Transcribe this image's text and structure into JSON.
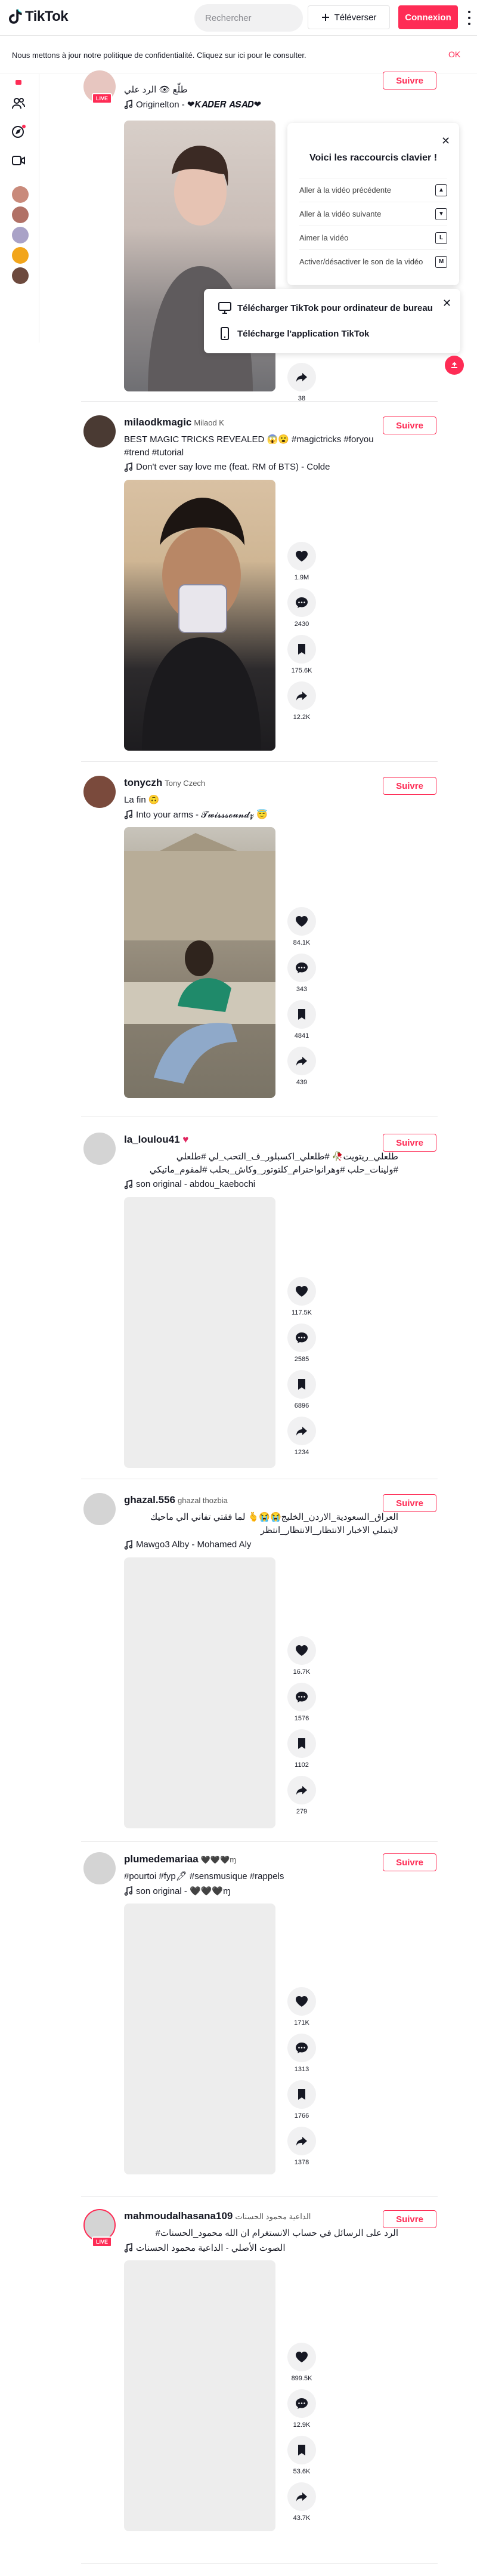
{
  "header": {
    "logo_text": "TikTok",
    "search_placeholder": "Rechercher",
    "upload_label": "Téléverser",
    "login_label": "Connexion"
  },
  "banner": {
    "text": "Nous mettons à jour notre politique de confidentialité. Cliquez sur ici pour le consulter.",
    "ok_label": "OK"
  },
  "keyboard_panel": {
    "title": "Voici les raccourcis clavier !",
    "shortcuts": [
      {
        "label": "Aller à la vidéo précédente",
        "key": "▲"
      },
      {
        "label": "Aller à la vidéo suivante",
        "key": "▼"
      },
      {
        "label": "Aimer la vidéo",
        "key": "L"
      },
      {
        "label": "Activer/désactiver le son de la vidéo",
        "key": "M"
      }
    ]
  },
  "download_panel": {
    "desktop_label": "Télécharger TikTok pour ordinateur de bureau",
    "mobile_label": "Télécharge l'application TikTok"
  },
  "posts": [
    {
      "username": "",
      "nickname": "",
      "caption": "طلّع 👁 الرد علي",
      "music": "Originelton - ❤𝑲𝑨𝑫𝑬𝑹 𝑨𝑺𝑨𝑫❤",
      "follow": "Suivre",
      "live": "LIVE",
      "actions": [
        {
          "count": "38"
        }
      ]
    },
    {
      "username": "milaodkmagic",
      "nickname": "Milaod K",
      "caption": "BEST MAGIC TRICKS REVEALED 😱😮 #magictricks #foryou #trend #tutorial",
      "music": "Don't ever say love me (feat. RM of BTS) - Colde",
      "follow": "Suivre",
      "actions": [
        {
          "count": "1.9M"
        },
        {
          "count": "2430"
        },
        {
          "count": "175.6K"
        },
        {
          "count": "12.2K"
        }
      ]
    },
    {
      "username": "tonyczh",
      "nickname": "Tony Czech",
      "caption": "La fin 🙃",
      "music": "Into your arms - 𝓣𝔀𝓲𝓼𝓼𝓼𝓸𝓾𝓷𝓭𝔃 😇",
      "follow": "Suivre",
      "actions": [
        {
          "count": "84.1K"
        },
        {
          "count": "343"
        },
        {
          "count": "4841"
        },
        {
          "count": "439"
        }
      ]
    },
    {
      "username": "la_loulou41",
      "nickname": "",
      "caption": "طلعلي_ريتويت🥀 #طلعلي_اكسبلور_ف_التحب_لي #طلعلي #ولينات_حلب #وهرانواحترام_كلتوتور_وكاش_بحلب #لمفوم_ماتيكي",
      "music": "son original - abdou_kaebochi",
      "follow": "Suivre",
      "actions": [
        {
          "count": "117.5K"
        },
        {
          "count": "2585"
        },
        {
          "count": "6896"
        },
        {
          "count": "1234"
        }
      ]
    },
    {
      "username": "ghazal.556",
      "nickname": "ghazal thozbia",
      "caption": "العراق_السعودية_الاردن_الخليج😭😭🫰 لما فقتي تفاني الي ماحيك لايتملي الاخبار الانتظار_الانتظار_انتظر",
      "music": "Mawgo3 Alby - Mohamed Aly",
      "follow": "Suivre",
      "actions": [
        {
          "count": "16.7K"
        },
        {
          "count": "1576"
        },
        {
          "count": "1102"
        },
        {
          "count": "279"
        }
      ]
    },
    {
      "username": "plumedemariaa",
      "nickname": "🖤🖤🖤ɱ",
      "caption": "#pourtoi #fyp🖊 #sensmusique #rappels",
      "music": "son original - 🖤🖤🖤ɱ",
      "follow": "Suivre",
      "actions": [
        {
          "count": "171K"
        },
        {
          "count": "1313"
        },
        {
          "count": "1766"
        },
        {
          "count": "1378"
        }
      ]
    },
    {
      "username": "mahmoudalhasana109",
      "nickname": "الداعية محمود الحسنات",
      "caption": "الرد على الرسائل في حساب الانستغرام ان الله محمود_الحسنات#",
      "music": "الصوت الأصلي - الداعية محمود الحسنات",
      "follow": "Suivre",
      "live": "LIVE",
      "actions": [
        {
          "count": "899.5K"
        },
        {
          "count": "12.9K"
        },
        {
          "count": "53.6K"
        },
        {
          "count": "43.7K"
        }
      ]
    }
  ]
}
